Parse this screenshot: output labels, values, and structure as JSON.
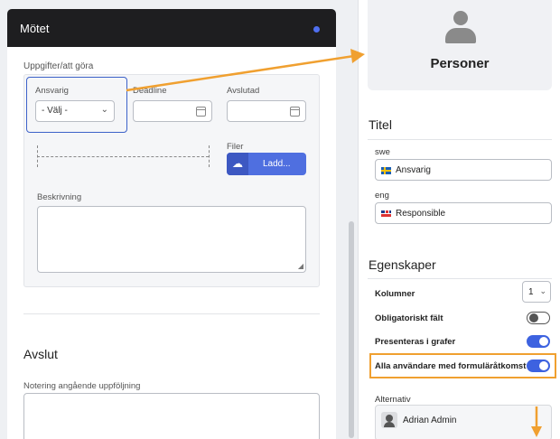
{
  "header": {
    "title": "Mötet"
  },
  "task": {
    "section_label": "Uppgifter/att göra",
    "ansvarig_label": "Ansvarig",
    "ansvarig_value": "- Välj -",
    "deadline_label": "Deadline",
    "avslutad_label": "Avslutad",
    "filer_label": "Filer",
    "upload_label": "Ladd...",
    "beskrivning_label": "Beskrivning"
  },
  "avslut": {
    "title": "Avslut",
    "notering_label": "Notering angående uppföljning"
  },
  "personer": {
    "title": "Personer"
  },
  "titel": {
    "heading": "Titel",
    "swe_label": "swe",
    "swe_value": "Ansvarig",
    "eng_label": "eng",
    "eng_value": "Responsible"
  },
  "egenskaper": {
    "heading": "Egenskaper",
    "kolumner_label": "Kolumner",
    "kolumner_value": "1",
    "obligatoriskt_label": "Obligatoriskt fält",
    "obligatoriskt_on": false,
    "presenteras_label": "Presenteras i grafer",
    "presenteras_on": true,
    "alla_label": "Alla användare med formuläråtkomst",
    "alla_on": true
  },
  "alternativ": {
    "label": "Alternativ",
    "items": [
      "Adrian Admin"
    ]
  },
  "colors": {
    "accent": "#3d62e0",
    "highlight": "#f0a030",
    "header_bg": "#1e1e20"
  }
}
